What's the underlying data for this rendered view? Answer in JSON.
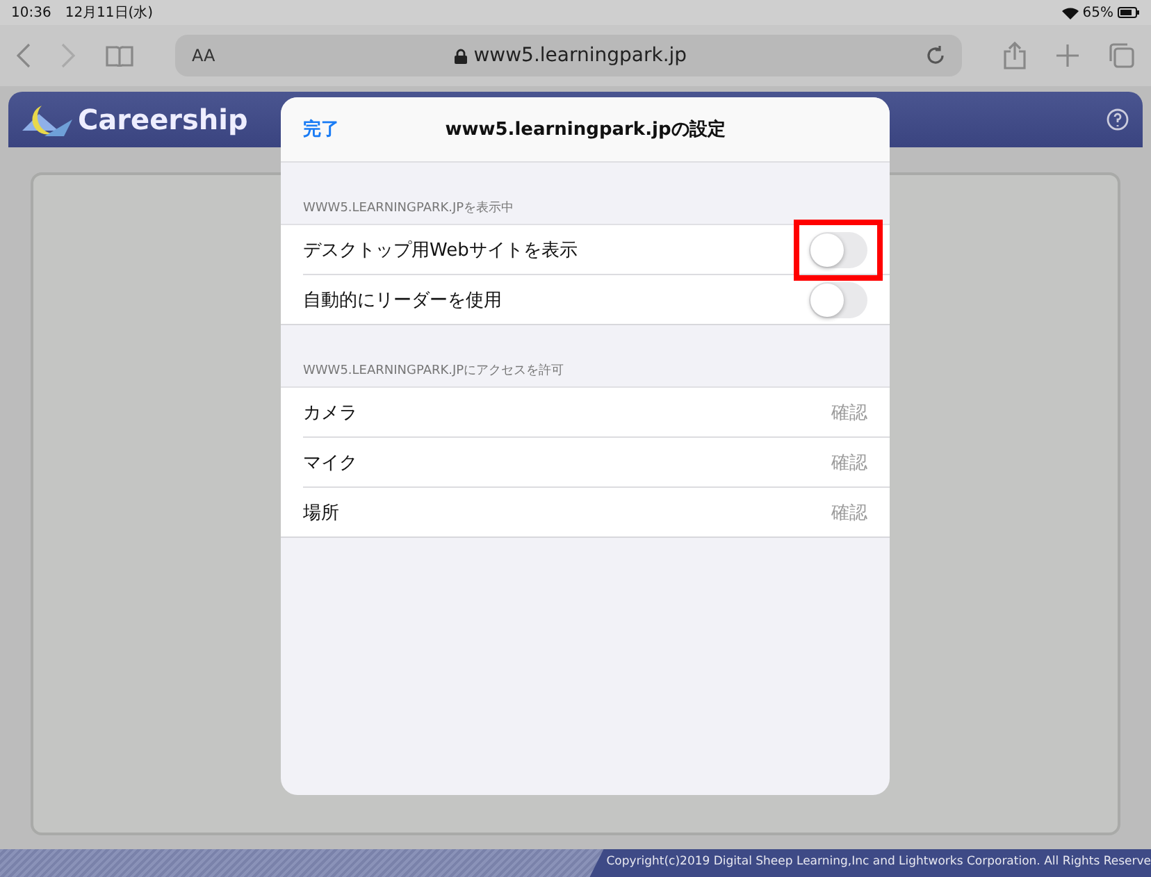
{
  "status_bar": {
    "time": "10:36",
    "date": "12月11日(水)",
    "battery": "65%"
  },
  "browser": {
    "text_size": "AA",
    "url": "www5.learningpark.jp"
  },
  "site": {
    "logo": "Careership",
    "copyright": "Copyright(c)2019 Digital Sheep Learning,Inc and Lightworks Corporation. All Rights Reserve"
  },
  "popover": {
    "done": "完了",
    "title": "www5.learningpark.jpの設定",
    "sections": [
      {
        "header": "WWW5.LEARNINGPARK.JPを表示中",
        "rows": [
          {
            "kind": "toggle",
            "label": "デスクトップ用Webサイトを表示",
            "on": false,
            "highlighted": true
          },
          {
            "kind": "toggle",
            "label": "自動的にリーダーを使用",
            "on": false,
            "highlighted": false
          }
        ]
      },
      {
        "header": "WWW5.LEARNINGPARK.JPにアクセスを許可",
        "rows": [
          {
            "kind": "value",
            "label": "カメラ",
            "value": "確認"
          },
          {
            "kind": "value",
            "label": "マイク",
            "value": "確認"
          },
          {
            "kind": "value",
            "label": "場所",
            "value": "確認"
          }
        ]
      }
    ]
  }
}
